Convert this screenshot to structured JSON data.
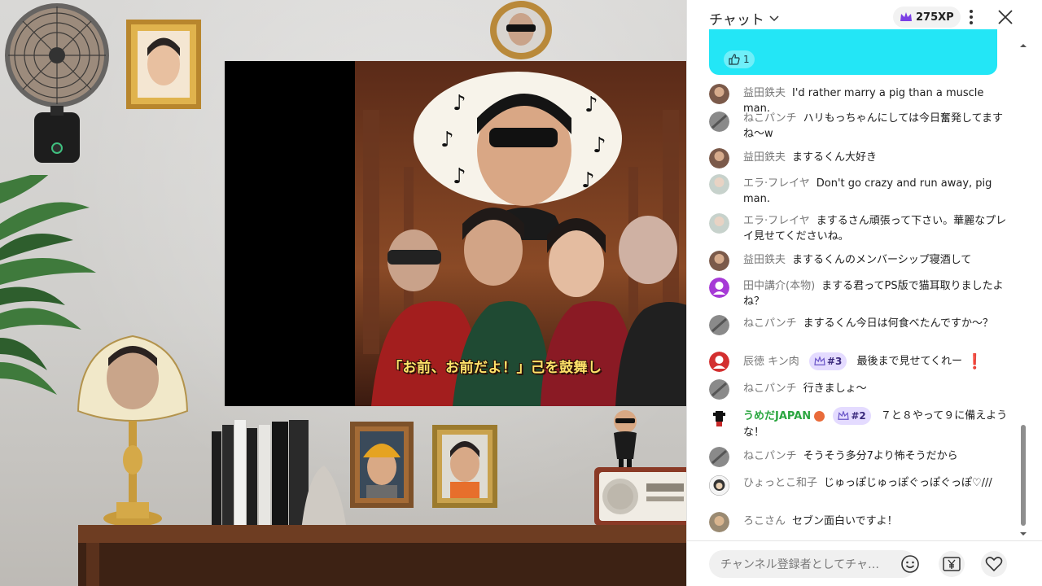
{
  "scene": {
    "caption": "「お前、お前だよ！」己を鼓舞し"
  },
  "chat": {
    "title": "チャット",
    "xp": "275XP",
    "pinned_like_count": "1",
    "input_placeholder": "チャンネル登録者としてチャ…",
    "messages": [
      {
        "author": "益田鉄夫",
        "text": "I'd rather marry a pig than a muscle man."
      },
      {
        "author": "ねこパンチ",
        "text": "ハリもっちゃんにしては今日奮発してますね〜w"
      },
      {
        "author": "益田鉄夫",
        "text": "まするくん大好き"
      },
      {
        "author": "エラ·フレイヤ",
        "text": "Don't go crazy and run away, pig man."
      },
      {
        "author": "エラ·フレイヤ",
        "text": "まするさん頑張って下さい。華麗なプレイ見せてくださいね。"
      },
      {
        "author": "益田鉄夫",
        "text": "まするくんのメンバーシップ寝酒して"
      },
      {
        "author": "田中講介(本物)",
        "text": "まする君ってPS版で猫耳取りましたよね？"
      },
      {
        "author": "ねこパンチ",
        "text": "まするくん今日は何食べたんですか〜？"
      },
      {
        "author": "辰徳 キン肉",
        "badge": "#3",
        "text": "最後まで見せてくれー"
      },
      {
        "author": "ねこパンチ",
        "text": "行きましょ〜"
      },
      {
        "author": "うめだJAPAN",
        "badge": "#2",
        "text": "７と８やって９に備えような！"
      },
      {
        "author": "ねこパンチ",
        "text": "そうそう多分7より怖そうだから"
      },
      {
        "author": "ひょっとこ和子",
        "text": "じゅっぽじゅっぽぐっぽぐっぽ♡///"
      },
      {
        "author": "ろこさん",
        "text": "セブン面白いですよ！"
      }
    ]
  },
  "colors": {
    "pinned_bg": "#23e6f6",
    "member_badge_bg": "#e4dbff",
    "owner_name": "#2ba640",
    "alert_red": "#e11d2c"
  }
}
